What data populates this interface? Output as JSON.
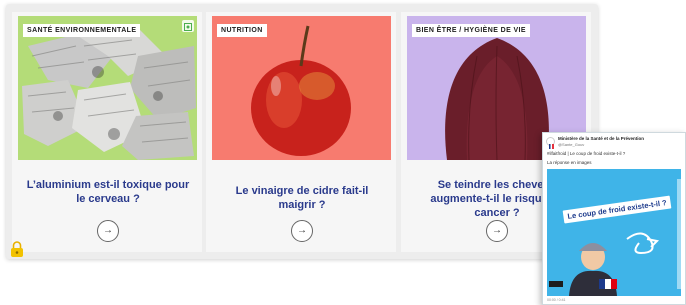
{
  "cards": [
    {
      "tag": "SANTÉ ENVIRONNEMENTALE",
      "title": "L’aluminium est-il toxique pour le cerveau ?",
      "image": "crushed aluminium cans",
      "color": "#b4dc78"
    },
    {
      "tag": "NUTRITION",
      "title": "Le vinaigre de cidre fait-il maigrir ?",
      "image": "red apple",
      "color": "#f77b6f"
    },
    {
      "tag": "BIEN ÊTRE / HYGIÈNE DE VIE",
      "title": "Se teindre les cheveux augmente-t-il le risque de cancer ?",
      "image": "woman hair from behind",
      "color": "#c9b4ec"
    }
  ],
  "arrow_icon": "→",
  "tweet": {
    "author": "Ministère de la Santé et de la Prévention",
    "handle": "@Sante_Gouv",
    "text1": "#ilfaitfroid | Le coup de froid existe-t-il ?",
    "text2": "La réponse en images",
    "media_label": "Le coup de froid existe-t-il ?",
    "footer": "00:00 / 0:41"
  },
  "colors": {
    "title_blue": "#2a3a8c",
    "tweet_media_bg": "#3fb4e8"
  }
}
